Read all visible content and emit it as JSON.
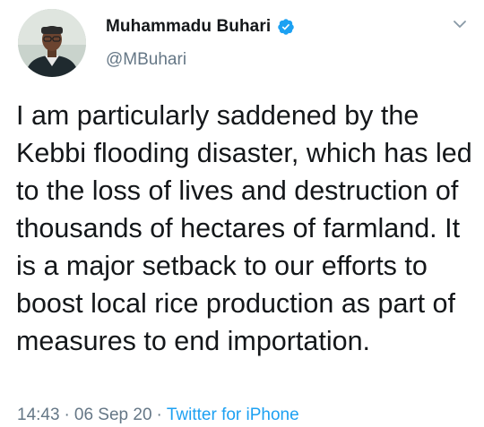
{
  "tweet": {
    "author": {
      "display_name": "Muhammadu Buhari",
      "handle": "@MBuhari",
      "verified": true,
      "avatar_icon": "profile-photo"
    },
    "text": "I am particularly saddened by the Kebbi flooding disaster, which has led to the loss of lives and destruction of thousands of hectares of farmland. It is a major setback to our efforts to boost local rice production as part of measures to end importation.",
    "time": "14:43",
    "date": "06 Sep 20",
    "separator": "·",
    "source": "Twitter for iPhone",
    "menu_icon": "chevron-down-icon"
  },
  "colors": {
    "text_primary": "#14171a",
    "text_secondary": "#657786",
    "accent": "#1da1f2",
    "background": "#ffffff"
  }
}
